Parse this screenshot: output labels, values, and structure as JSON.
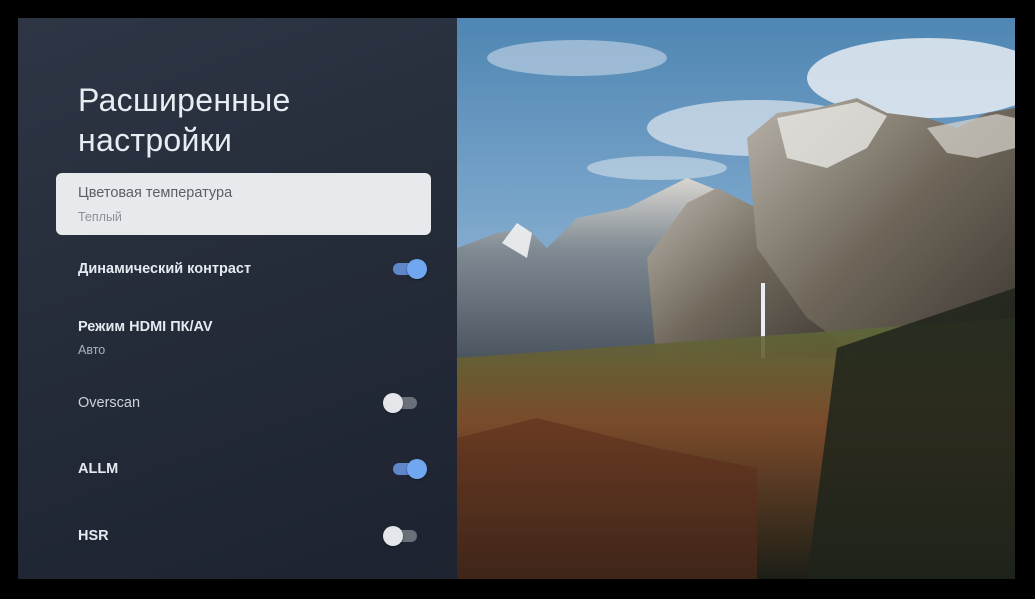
{
  "panel": {
    "title": "Расширенные настройки",
    "items": [
      {
        "label": "Цветовая температура",
        "value": "Теплый",
        "selected": true
      },
      {
        "label": "Динамический контраст",
        "toggle": "on"
      },
      {
        "label": "Режим HDMI ПК/AV",
        "value": "Авто"
      },
      {
        "label": "Overscan",
        "toggle": "off"
      },
      {
        "label": "ALLM",
        "toggle": "on"
      },
      {
        "label": "HSR",
        "toggle": "off"
      }
    ]
  },
  "colors": {
    "panel_bg": "#2a3140",
    "selected_bg": "#e8e9ec",
    "toggle_on": "#6fa7f0",
    "toggle_off": "#e4e6ea"
  },
  "icons": [
    "toggle-switch"
  ]
}
